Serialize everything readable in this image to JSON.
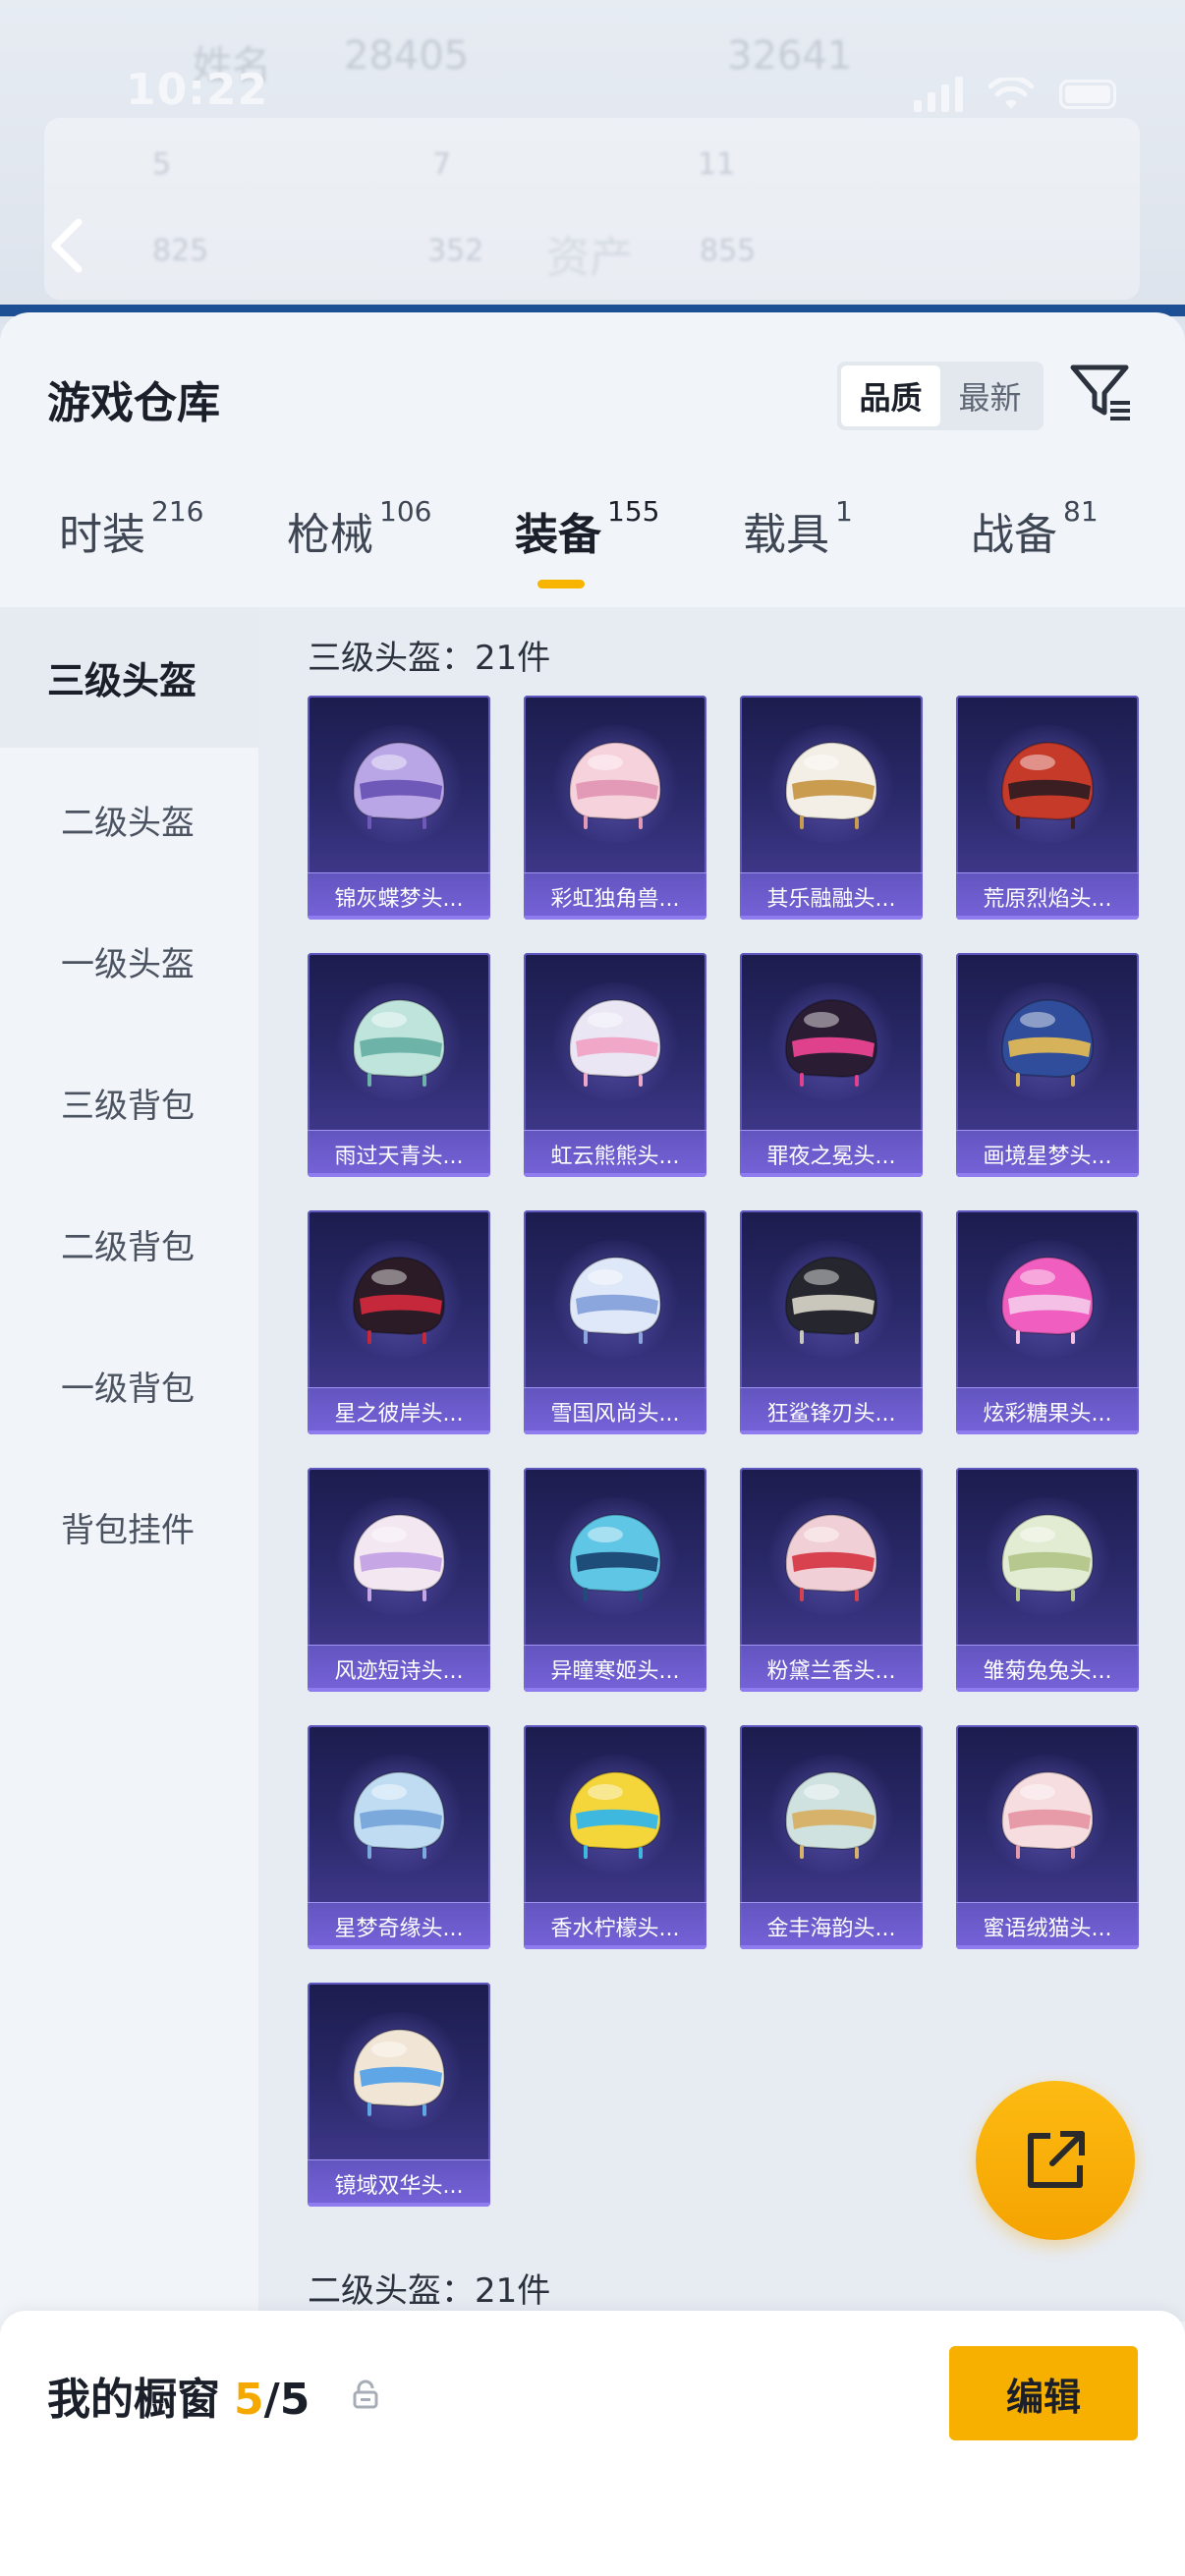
{
  "status_bar": {
    "time": "10:22"
  },
  "background": {
    "ghost_texts": [
      "姓名",
      "28405",
      "32641",
      "5",
      "7",
      "11",
      "825",
      "352",
      "资产",
      "855"
    ],
    "title": "资产"
  },
  "sheet": {
    "title": "游戏仓库",
    "sort_options": [
      {
        "label": "品质",
        "active": true
      },
      {
        "label": "最新",
        "active": false
      }
    ]
  },
  "tabs": [
    {
      "label": "时装",
      "count": "216",
      "active": false
    },
    {
      "label": "枪械",
      "count": "106",
      "active": false
    },
    {
      "label": "装备",
      "count": "155",
      "active": true
    },
    {
      "label": "载具",
      "count": "1",
      "active": false
    },
    {
      "label": "战备",
      "count": "81",
      "active": false
    }
  ],
  "sidebar": {
    "items": [
      {
        "label": "三级头盔",
        "active": true
      },
      {
        "label": "二级头盔",
        "active": false
      },
      {
        "label": "一级头盔",
        "active": false
      },
      {
        "label": "三级背包",
        "active": false
      },
      {
        "label": "二级背包",
        "active": false
      },
      {
        "label": "一级背包",
        "active": false
      },
      {
        "label": "背包挂件",
        "active": false
      }
    ]
  },
  "sections": [
    {
      "title": "三级头盔：21件",
      "items": [
        {
          "name": "锦灰蝶梦头...",
          "color": "#b9a6e6",
          "accent": "#6e58b8"
        },
        {
          "name": "彩虹独角兽...",
          "color": "#f6d2dc",
          "accent": "#e39ab6"
        },
        {
          "name": "其乐融融头...",
          "color": "#f4efe6",
          "accent": "#c99c4f"
        },
        {
          "name": "荒原烈焰头...",
          "color": "#c63a2a",
          "accent": "#3a1e22"
        },
        {
          "name": "雨过天青头...",
          "color": "#bfe4dc",
          "accent": "#6db3a8"
        },
        {
          "name": "虹云熊熊头...",
          "color": "#eae6f4",
          "accent": "#f0a7c8"
        },
        {
          "name": "罪夜之冕头...",
          "color": "#2a1d33",
          "accent": "#e0418c"
        },
        {
          "name": "画境星梦头...",
          "color": "#2f4d9a",
          "accent": "#d6b35a"
        },
        {
          "name": "星之彼岸头...",
          "color": "#2b1b26",
          "accent": "#c4283a"
        },
        {
          "name": "雪国风尚头...",
          "color": "#dfe8f8",
          "accent": "#8aa6dc"
        },
        {
          "name": "狂鲨锋刃头...",
          "color": "#26272e",
          "accent": "#c9c6bc"
        },
        {
          "name": "炫彩糖果头...",
          "color": "#f05fc0",
          "accent": "#f4c0e6"
        },
        {
          "name": "风迹短诗头...",
          "color": "#f3e8f2",
          "accent": "#c7a6e6"
        },
        {
          "name": "异瞳寒姬头...",
          "color": "#5fc6e6",
          "accent": "#1f4d7a"
        },
        {
          "name": "粉黛兰香头...",
          "color": "#f0d0d6",
          "accent": "#d8424e"
        },
        {
          "name": "雏菊兔兔头...",
          "color": "#e2ecd2",
          "accent": "#b6c88e"
        },
        {
          "name": "星梦奇缘头...",
          "color": "#bfdcf2",
          "accent": "#7ba9dc"
        },
        {
          "name": "香水柠檬头...",
          "color": "#f4d63a",
          "accent": "#3fb8e0"
        },
        {
          "name": "金丰海韵头...",
          "color": "#cfe2e0",
          "accent": "#d6b26a"
        },
        {
          "name": "蜜语绒猫头...",
          "color": "#f6dde0",
          "accent": "#e79aa8"
        },
        {
          "name": "镜域双华头...",
          "color": "#f1e6d6",
          "accent": "#5fa6e6"
        }
      ]
    },
    {
      "title": "二级头盔：21件",
      "items": []
    }
  ],
  "bottom_bar": {
    "label": "我的橱窗",
    "current": "5",
    "separator": "/",
    "max": "5",
    "edit_label": "编辑"
  },
  "colors": {
    "accent": "#f7b000",
    "card_top": "#1c1c4e",
    "card_bottom": "#4a3f9a"
  }
}
